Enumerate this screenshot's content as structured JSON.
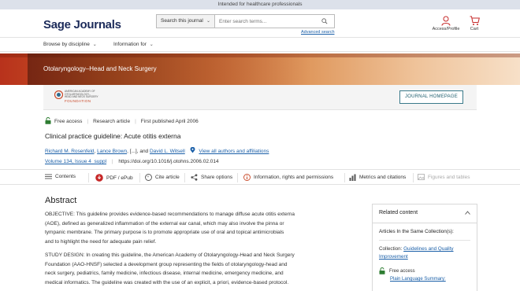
{
  "topbar": {
    "text": "Intended for healthcare professionals"
  },
  "header": {
    "logo": "Sage Journals",
    "search_scope": "Search this journal",
    "search_placeholder": "Enter search terms...",
    "advanced_search": "Advanced search",
    "access_label": "Access/Profile",
    "cart_label": "Cart"
  },
  "nav": {
    "items": [
      "Browse by discipline",
      "Information for"
    ]
  },
  "banner": {
    "title": "Otolaryngology–Head and Neck Surgery"
  },
  "journal": {
    "society_lines": [
      "AMERICAN ACADEMY OF",
      "OTOLARYNGOLOGY–",
      "HEAD AND NECK SURGERY"
    ],
    "society_foundation": "FOUNDATION",
    "homepage_button": "JOURNAL HOMEPAGE"
  },
  "article": {
    "access": "Free access",
    "type": "Research article",
    "published": "First published April 2006",
    "title": "Clinical practice guideline: Acute otitis externa",
    "authors": [
      "Richard M. Rosenfeld",
      "Lance Brown",
      "David L. Witsell"
    ],
    "authors_sep_1": ", ",
    "authors_mid": ", [...], and ",
    "view_all": "View all authors and affiliations",
    "volume": "Volume 134, Issue 4_suppl",
    "doi": "https://doi.org/10.1016/j.otohns.2006.02.014"
  },
  "toolbar": {
    "contents": "Contents",
    "pdf": "PDF / ePub",
    "cite": "Cite article",
    "share": "Share options",
    "info": "Information, rights and permissions",
    "metrics": "Metrics and citations",
    "figures": "Figures and tables"
  },
  "abstract": {
    "heading": "Abstract",
    "lines": [
      "OBJECTIVE: This guideline provides evidence-based recommendations to manage diffuse acute otitis externa",
      "(AOE), defined as generalized inflammation of the external ear canal, which may also involve the pinna or",
      "tympanic membrane. The primary purpose is to promote appropriate use of oral and topical antimicrobials",
      "and to highlight the need for adequate pain relief.",
      "STUDY DESIGN: In creating this guideline, the American Academy of Otolaryngology-Head and Neck Surgery",
      "Foundation (AAO-HNSF) selected a development group representing the fields of otolaryngology-head and",
      "neck surgery, pediatrics, family medicine, infectious disease, internal medicine, emergency medicine, and",
      "medical informatics. The guideline was created with the use of an explicit, a priori, evidence-based protocol."
    ]
  },
  "related": {
    "heading": "Related content",
    "subheading": "Articles In the Same Collection(s):",
    "collection_prefix": "Collection: ",
    "collection_link": "Guidelines and Quality Improvement",
    "free_access": "Free access",
    "summary_link": "Plain Language Summary:"
  },
  "colors": {
    "brand_navy": "#1c2b5a",
    "link_blue": "#1a5fa8",
    "free_access_green": "#2e7d32",
    "pdf_red": "#c62828",
    "banner_orange": "#c85a24"
  }
}
